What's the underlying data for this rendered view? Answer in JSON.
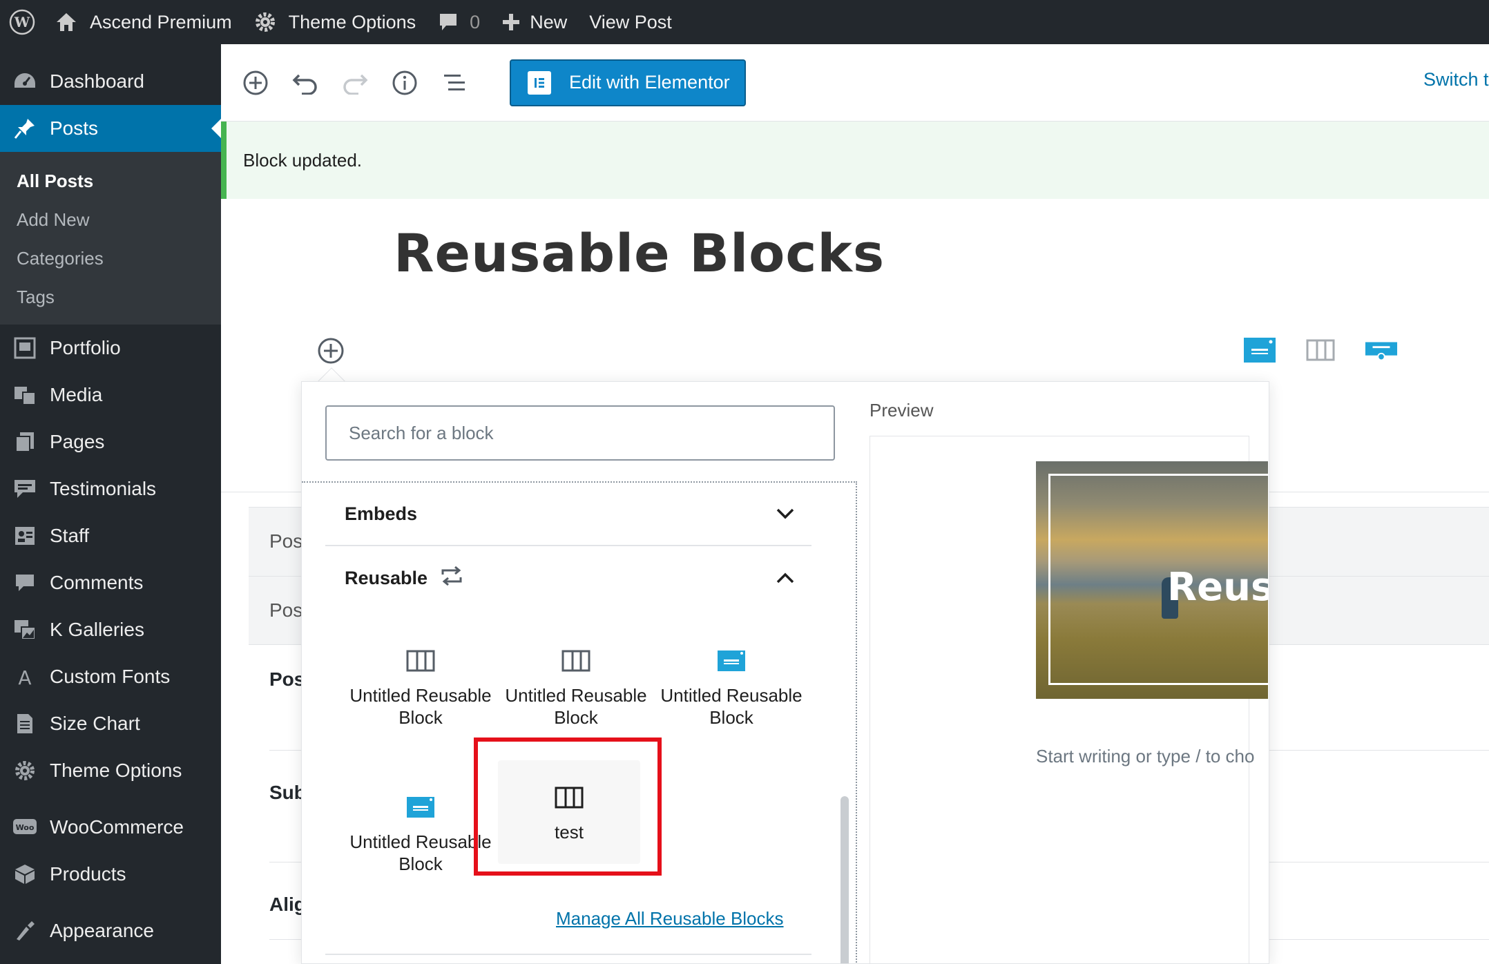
{
  "admin_bar": {
    "site_name": "Ascend Premium",
    "theme_options": "Theme Options",
    "comments_count": "0",
    "new_label": "New",
    "view_post": "View Post"
  },
  "sidebar": {
    "items": [
      {
        "label": "Dashboard",
        "icon": "dashboard-icon"
      },
      {
        "label": "Posts",
        "icon": "pin-icon",
        "current": true
      },
      {
        "label": "Portfolio",
        "icon": "portfolio-icon"
      },
      {
        "label": "Media",
        "icon": "media-icon"
      },
      {
        "label": "Pages",
        "icon": "pages-icon"
      },
      {
        "label": "Testimonials",
        "icon": "testimonials-icon"
      },
      {
        "label": "Staff",
        "icon": "staff-icon"
      },
      {
        "label": "Comments",
        "icon": "comments-icon"
      },
      {
        "label": "K Galleries",
        "icon": "galleries-icon"
      },
      {
        "label": "Custom Fonts",
        "icon": "font-icon"
      },
      {
        "label": "Size Chart",
        "icon": "size-chart-icon"
      },
      {
        "label": "Theme Options",
        "icon": "gear-icon"
      },
      {
        "label": "WooCommerce",
        "icon": "woocommerce-icon"
      },
      {
        "label": "Products",
        "icon": "products-icon"
      },
      {
        "label": "Appearance",
        "icon": "appearance-icon"
      }
    ],
    "submenu": [
      "All Posts",
      "Add New",
      "Categories",
      "Tags"
    ]
  },
  "toolbar": {
    "elementor_label": "Edit with Elementor",
    "switch_label": "Switch t"
  },
  "notice": {
    "text": "Block updated."
  },
  "post": {
    "title": "Reusable Blocks"
  },
  "meta_labels": [
    "Pos",
    "Pos",
    "Pos",
    "Sub",
    "Alig"
  ],
  "inserter": {
    "search_placeholder": "Search for a block",
    "panels": {
      "embeds": "Embeds",
      "reusable": "Reusable"
    },
    "blocks": [
      {
        "label": "Untitled Reusable Block",
        "icon": "columns-icon"
      },
      {
        "label": "Untitled Reusable Block",
        "icon": "columns-icon"
      },
      {
        "label": "Untitled Reusable Block",
        "icon": "cover-blue-icon"
      },
      {
        "label": "Untitled Reusable Block",
        "icon": "cover-blue-icon"
      },
      {
        "label": "test",
        "icon": "columns-icon",
        "highlighted": true
      }
    ],
    "manage_link": "Manage All Reusable Blocks",
    "preview_label": "Preview",
    "preview_overlay": "Reusa",
    "preview_placeholder": "Start writing or type / to cho"
  },
  "colors": {
    "admin_dark": "#23282d",
    "accent_blue": "#0073aa",
    "elementor_blue": "#0e86c9",
    "highlight_red": "#e5101a",
    "notice_green": "#46b450"
  }
}
